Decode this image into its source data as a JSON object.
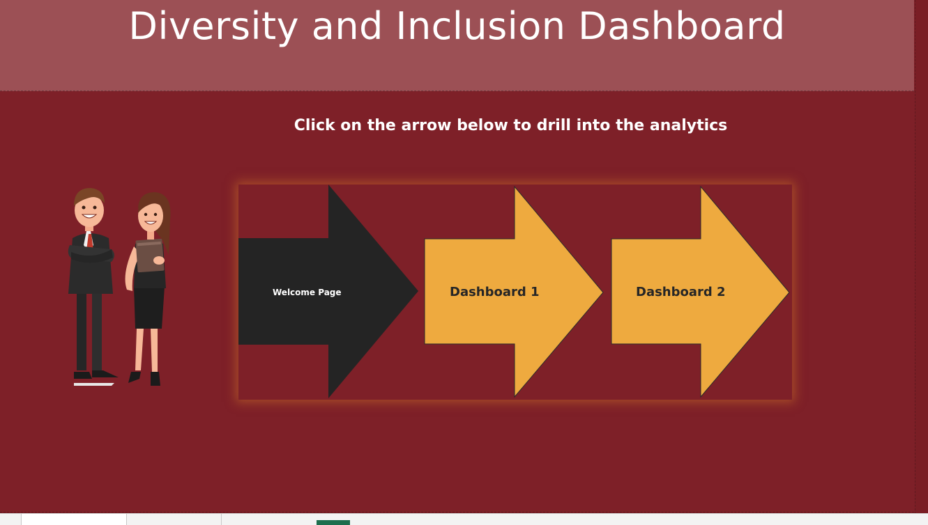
{
  "header": {
    "title": "Diversity and Inclusion Dashboard"
  },
  "instruction": "Click on the arrow below to drill into the analytics",
  "arrows": [
    {
      "label": "Welcome Page",
      "fill": "#242424"
    },
    {
      "label": "Dashboard 1",
      "fill": "#eeaa3f"
    },
    {
      "label": "Dashboard 2",
      "fill": "#eeaa3f"
    }
  ],
  "colors": {
    "background": "#7e2028",
    "banner": "#9c5055",
    "arrow_dark": "#242424",
    "arrow_gold": "#eeaa3f"
  },
  "illustration": {
    "icon": "business-people-illustration"
  },
  "sheet_tabs": [
    {
      "name": "sheet-tab-1",
      "active": true
    },
    {
      "name": "sheet-tab-2",
      "active": false
    },
    {
      "name": "sheet-tab-3",
      "active": false
    }
  ]
}
